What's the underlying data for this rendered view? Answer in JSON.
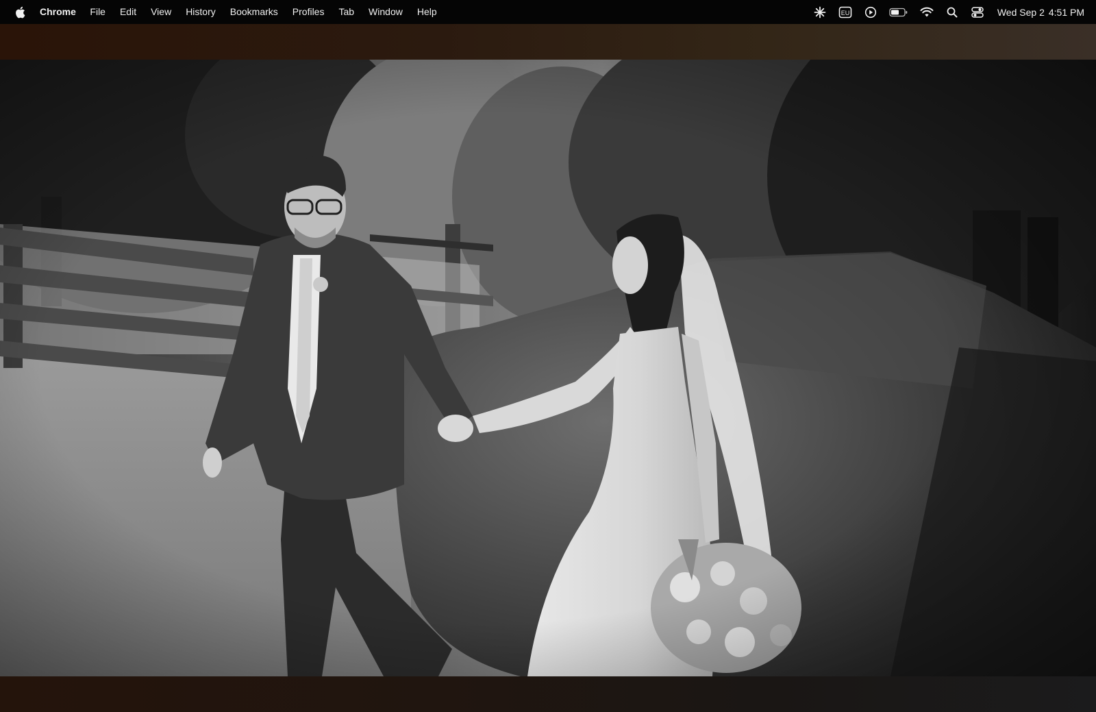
{
  "menubar": {
    "apple_icon": "apple-logo-icon",
    "app_name": "Chrome",
    "items": [
      "File",
      "Edit",
      "View",
      "History",
      "Bookmarks",
      "Profiles",
      "Tab",
      "Window",
      "Help"
    ],
    "status_icons": [
      "sparkle-icon",
      "input-source-eu-icon",
      "play-circle-icon",
      "battery-icon",
      "wifi-icon",
      "search-icon",
      "control-center-icon"
    ],
    "input_source_label": "EU",
    "clock": {
      "date": "Wed Sep 2",
      "time": "4:51 PM"
    }
  },
  "browser": {
    "top_band_color": "#2a1408",
    "bottom_band_color": "#1b1b1c"
  },
  "video": {
    "style": "black-and-white",
    "icon": "wedding-couple-photo"
  }
}
